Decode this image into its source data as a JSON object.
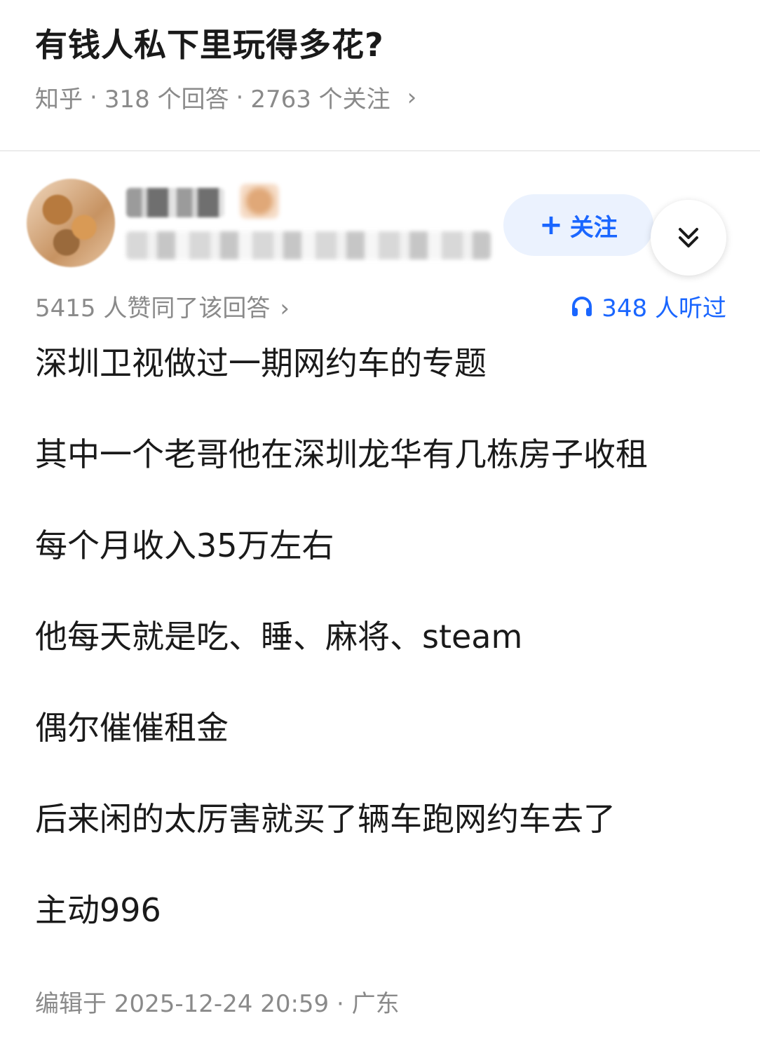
{
  "question": {
    "title": "有钱人私下里玩得多花?",
    "source": "知乎",
    "answers": "318 个回答",
    "followers": "2763 个关注",
    "chevron": "›"
  },
  "answer": {
    "follow_label": "关注",
    "likes_text": "5415 人赞同了该回答",
    "likes_chevron": "›",
    "listened_text": "348 人听过",
    "paragraphs": [
      "深圳卫视做过一期网约车的专题",
      "其中一个老哥他在深圳龙华有几栋房子收租",
      "每个月收入35万左右",
      "他每天就是吃、睡、麻将、steam",
      "偶尔催催租金",
      "后来闲的太厉害就买了辆车跑网约车去了",
      "主动996"
    ],
    "edited": "编辑于 2025-12-24 20:59 · 广东"
  },
  "icons": {
    "follow": "plus-icon",
    "expand": "double-chevron-down-icon",
    "listened": "headphones-icon"
  },
  "colors": {
    "accent": "#1a66ff",
    "follow_bg": "#ebf2fe",
    "muted": "#8a8a8a"
  }
}
